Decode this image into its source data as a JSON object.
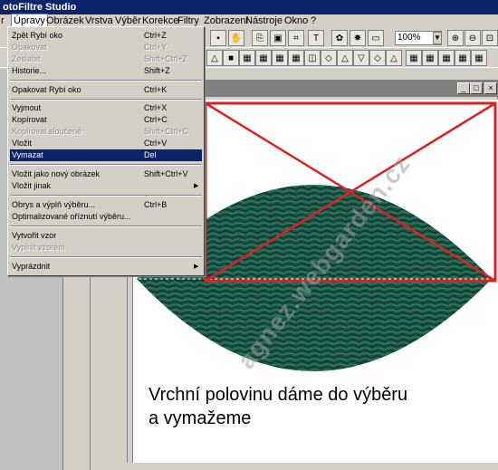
{
  "app": {
    "title": "otoFiltre Studio"
  },
  "menubar": [
    "r",
    "Úpravy",
    "Obrázek",
    "Vrstva",
    "Výběr",
    "Korekce",
    "Filtry",
    "Zobrazení",
    "Nástroje",
    "Okno",
    "?"
  ],
  "zoom": {
    "value": "100%"
  },
  "edit_menu": [
    {
      "label": "Zpět Rybí oko",
      "shortcut": "Ctrl+Z",
      "state": "normal"
    },
    {
      "label": "Opakovat",
      "shortcut": "Ctrl+Y",
      "state": "disabled"
    },
    {
      "label": "Zeslabit",
      "shortcut": "Shift+Ctrl+Z",
      "state": "disabled"
    },
    {
      "label": "Historie...",
      "shortcut": "Shift+Z",
      "state": "normal"
    },
    {
      "label": "Opakovat Rybí oko",
      "shortcut": "Ctrl+K",
      "state": "normal"
    },
    {
      "label": "Vyjmout",
      "shortcut": "Ctrl+X",
      "state": "normal"
    },
    {
      "label": "Kopírovat",
      "shortcut": "Ctrl+C",
      "state": "normal"
    },
    {
      "label": "Kopírovat sloučené",
      "shortcut": "Shift+Ctrl+C",
      "state": "disabled"
    },
    {
      "label": "Vložit",
      "shortcut": "Ctrl+V",
      "state": "normal"
    },
    {
      "label": "Vymazat",
      "shortcut": "Del",
      "state": "selected"
    },
    {
      "label": "Vložit jako nový obrázek",
      "shortcut": "Shift+Ctrl+V",
      "state": "normal"
    },
    {
      "label": "Vložit jinak",
      "shortcut": "",
      "state": "submenu"
    },
    {
      "label": "Obrys a výplň výběru...",
      "shortcut": "Ctrl+B",
      "state": "normal"
    },
    {
      "label": "Optimalizované oříznutí výběru...",
      "shortcut": "",
      "state": "normal"
    },
    {
      "label": "Vytvořit vzor",
      "shortcut": "",
      "state": "normal"
    },
    {
      "label": "Vyplnit vzorem",
      "shortcut": "",
      "state": "disabled"
    },
    {
      "label": "Vyprázdnit",
      "shortcut": "",
      "state": "submenu"
    }
  ],
  "canvas": {
    "caption_line1": "Vrchní polovinu dáme do výběru",
    "caption_line2": "a vymažeme",
    "watermark": "agnez.webgarden.cz"
  },
  "colors": {
    "selection_outline": "#e02020",
    "ellipse_fill": "#1d5a4a",
    "menu_highlight": "#0a246a",
    "title_bar": "#0a246a"
  }
}
